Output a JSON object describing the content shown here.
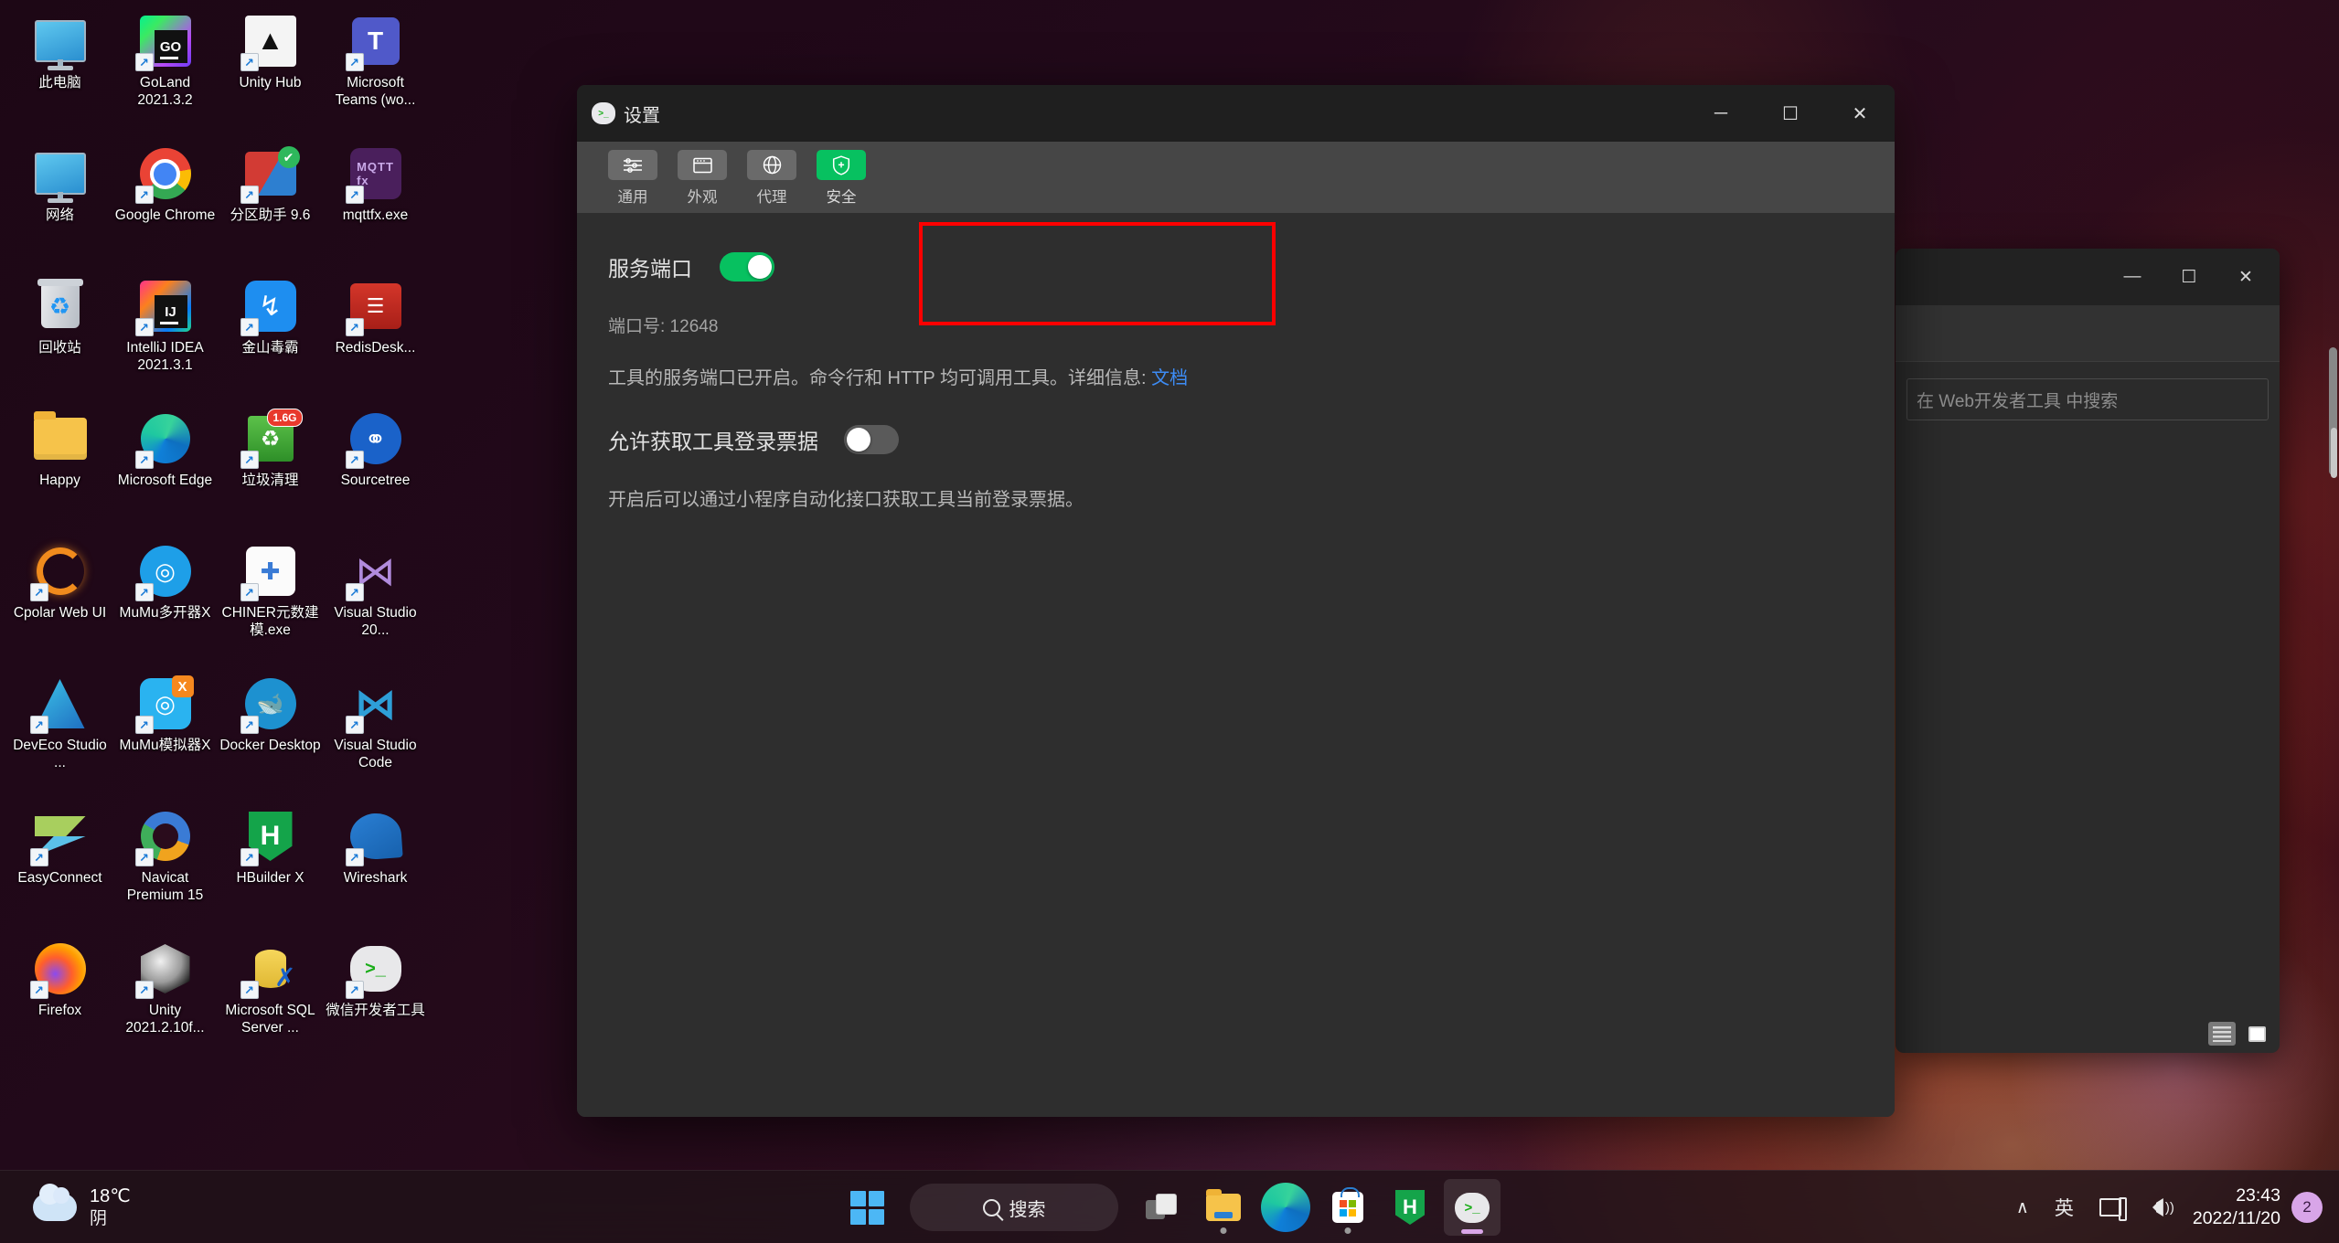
{
  "desktop": {
    "icons": [
      {
        "label": "此电脑",
        "art": "pc",
        "shortcut": false
      },
      {
        "label": "GoLand 2021.3.2",
        "art": "goland",
        "shortcut": true
      },
      {
        "label": "Unity Hub",
        "art": "unity-hub",
        "shortcut": true
      },
      {
        "label": "Microsoft Teams (wo...",
        "art": "teams",
        "shortcut": true
      },
      {
        "label": "网络",
        "art": "network",
        "shortcut": false
      },
      {
        "label": "Google Chrome",
        "art": "chrome",
        "shortcut": true
      },
      {
        "label": "分区助手 9.6",
        "art": "partition-assistant",
        "shortcut": true
      },
      {
        "label": "mqttfx.exe",
        "art": "mqttfx",
        "shortcut": true
      },
      {
        "label": "回收站",
        "art": "recycle-bin",
        "shortcut": false
      },
      {
        "label": "IntelliJ IDEA 2021.3.1",
        "art": "intellij",
        "shortcut": true
      },
      {
        "label": "金山毒霸",
        "art": "kingsoft",
        "shortcut": true
      },
      {
        "label": "RedisDesk...",
        "art": "redis-desktop",
        "shortcut": true
      },
      {
        "label": "Happy",
        "art": "folder",
        "shortcut": false
      },
      {
        "label": "Microsoft Edge",
        "art": "edge",
        "shortcut": true
      },
      {
        "label": "垃圾清理",
        "art": "cleaner",
        "badge": "1.6G",
        "shortcut": true
      },
      {
        "label": "Sourcetree",
        "art": "sourcetree",
        "shortcut": true
      },
      {
        "label": "Cpolar Web UI",
        "art": "cpolar",
        "shortcut": true
      },
      {
        "label": "MuMu多开器X",
        "art": "mumu-multi",
        "shortcut": true
      },
      {
        "label": "CHINER元数建模.exe",
        "art": "chiner",
        "shortcut": true
      },
      {
        "label": "Visual Studio 20...",
        "art": "visual-studio",
        "shortcut": true
      },
      {
        "label": "DevEco Studio ...",
        "art": "deveco",
        "shortcut": true
      },
      {
        "label": "MuMu模拟器X",
        "art": "mumu-emu",
        "shortcut": true
      },
      {
        "label": "Docker Desktop",
        "art": "docker",
        "shortcut": true
      },
      {
        "label": "Visual Studio Code",
        "art": "vscode",
        "shortcut": true
      },
      {
        "label": "EasyConnect",
        "art": "easyconnect",
        "shortcut": true
      },
      {
        "label": "Navicat Premium 15",
        "art": "navicat",
        "shortcut": true
      },
      {
        "label": "HBuilder X",
        "art": "hbuilder",
        "shortcut": true
      },
      {
        "label": "Wireshark",
        "art": "wireshark",
        "shortcut": true
      },
      {
        "label": "Firefox",
        "art": "firefox",
        "shortcut": true
      },
      {
        "label": "Unity 2021.2.10f...",
        "art": "unity",
        "shortcut": true
      },
      {
        "label": "Microsoft SQL Server ...",
        "art": "sql-server",
        "shortcut": true
      },
      {
        "label": "微信开发者工具",
        "art": "wx-devtools",
        "shortcut": true
      }
    ]
  },
  "background_window": {
    "search_placeholder": "在 Web开发者工具 中搜索",
    "minimize_label": "—",
    "maximize_label": "☐",
    "close_label": "✕"
  },
  "settings_window": {
    "title": "设置",
    "window_buttons": {
      "minimize": "─",
      "maximize": "☐",
      "close": "✕"
    },
    "tabs": [
      {
        "label": "通用",
        "icon": "sliders-icon",
        "active": false
      },
      {
        "label": "外观",
        "icon": "layout-icon",
        "active": false
      },
      {
        "label": "代理",
        "icon": "globe-icon",
        "active": false
      },
      {
        "label": "安全",
        "icon": "shield-plus-icon",
        "active": true
      }
    ],
    "security": {
      "service_port_label": "服务端口",
      "service_port_toggle": "on",
      "port_number_text": "端口号: 12648",
      "port_number_value": "12648",
      "description_prefix": "工具的服务端口已开启。命令行和 HTTP 均可调用工具。详细信息: ",
      "description_link": "文档",
      "ticket_label": "允许获取工具登录票据",
      "ticket_toggle": "off",
      "ticket_description": "开启后可以通过小程序自动化接口获取工具当前登录票据。"
    },
    "highlight_color": "#fe0000",
    "accent_color": "#07c160"
  },
  "taskbar": {
    "weather": {
      "temperature": "18℃",
      "condition": "阴",
      "icon": "cloud-icon"
    },
    "start_label": "开始",
    "search_placeholder": "搜索",
    "items": [
      {
        "name": "task-view",
        "label": "任务视图",
        "running": false
      },
      {
        "name": "file-explorer",
        "label": "文件资源管理器",
        "running": true
      },
      {
        "name": "microsoft-edge",
        "label": "Microsoft Edge",
        "running": false
      },
      {
        "name": "microsoft-store",
        "label": "Microsoft Store",
        "running": true
      },
      {
        "name": "hbuilder-x",
        "label": "HBuilder X",
        "running": false
      },
      {
        "name": "wechat-devtools",
        "label": "微信开发者工具",
        "running": true,
        "focused": true
      }
    ],
    "tray": {
      "chevron": "∧",
      "ime": "英",
      "network_icon": "network-icon",
      "volume_icon": "volume-icon",
      "time": "23:43",
      "date": "2022/11/20",
      "badge_count": "2"
    }
  }
}
